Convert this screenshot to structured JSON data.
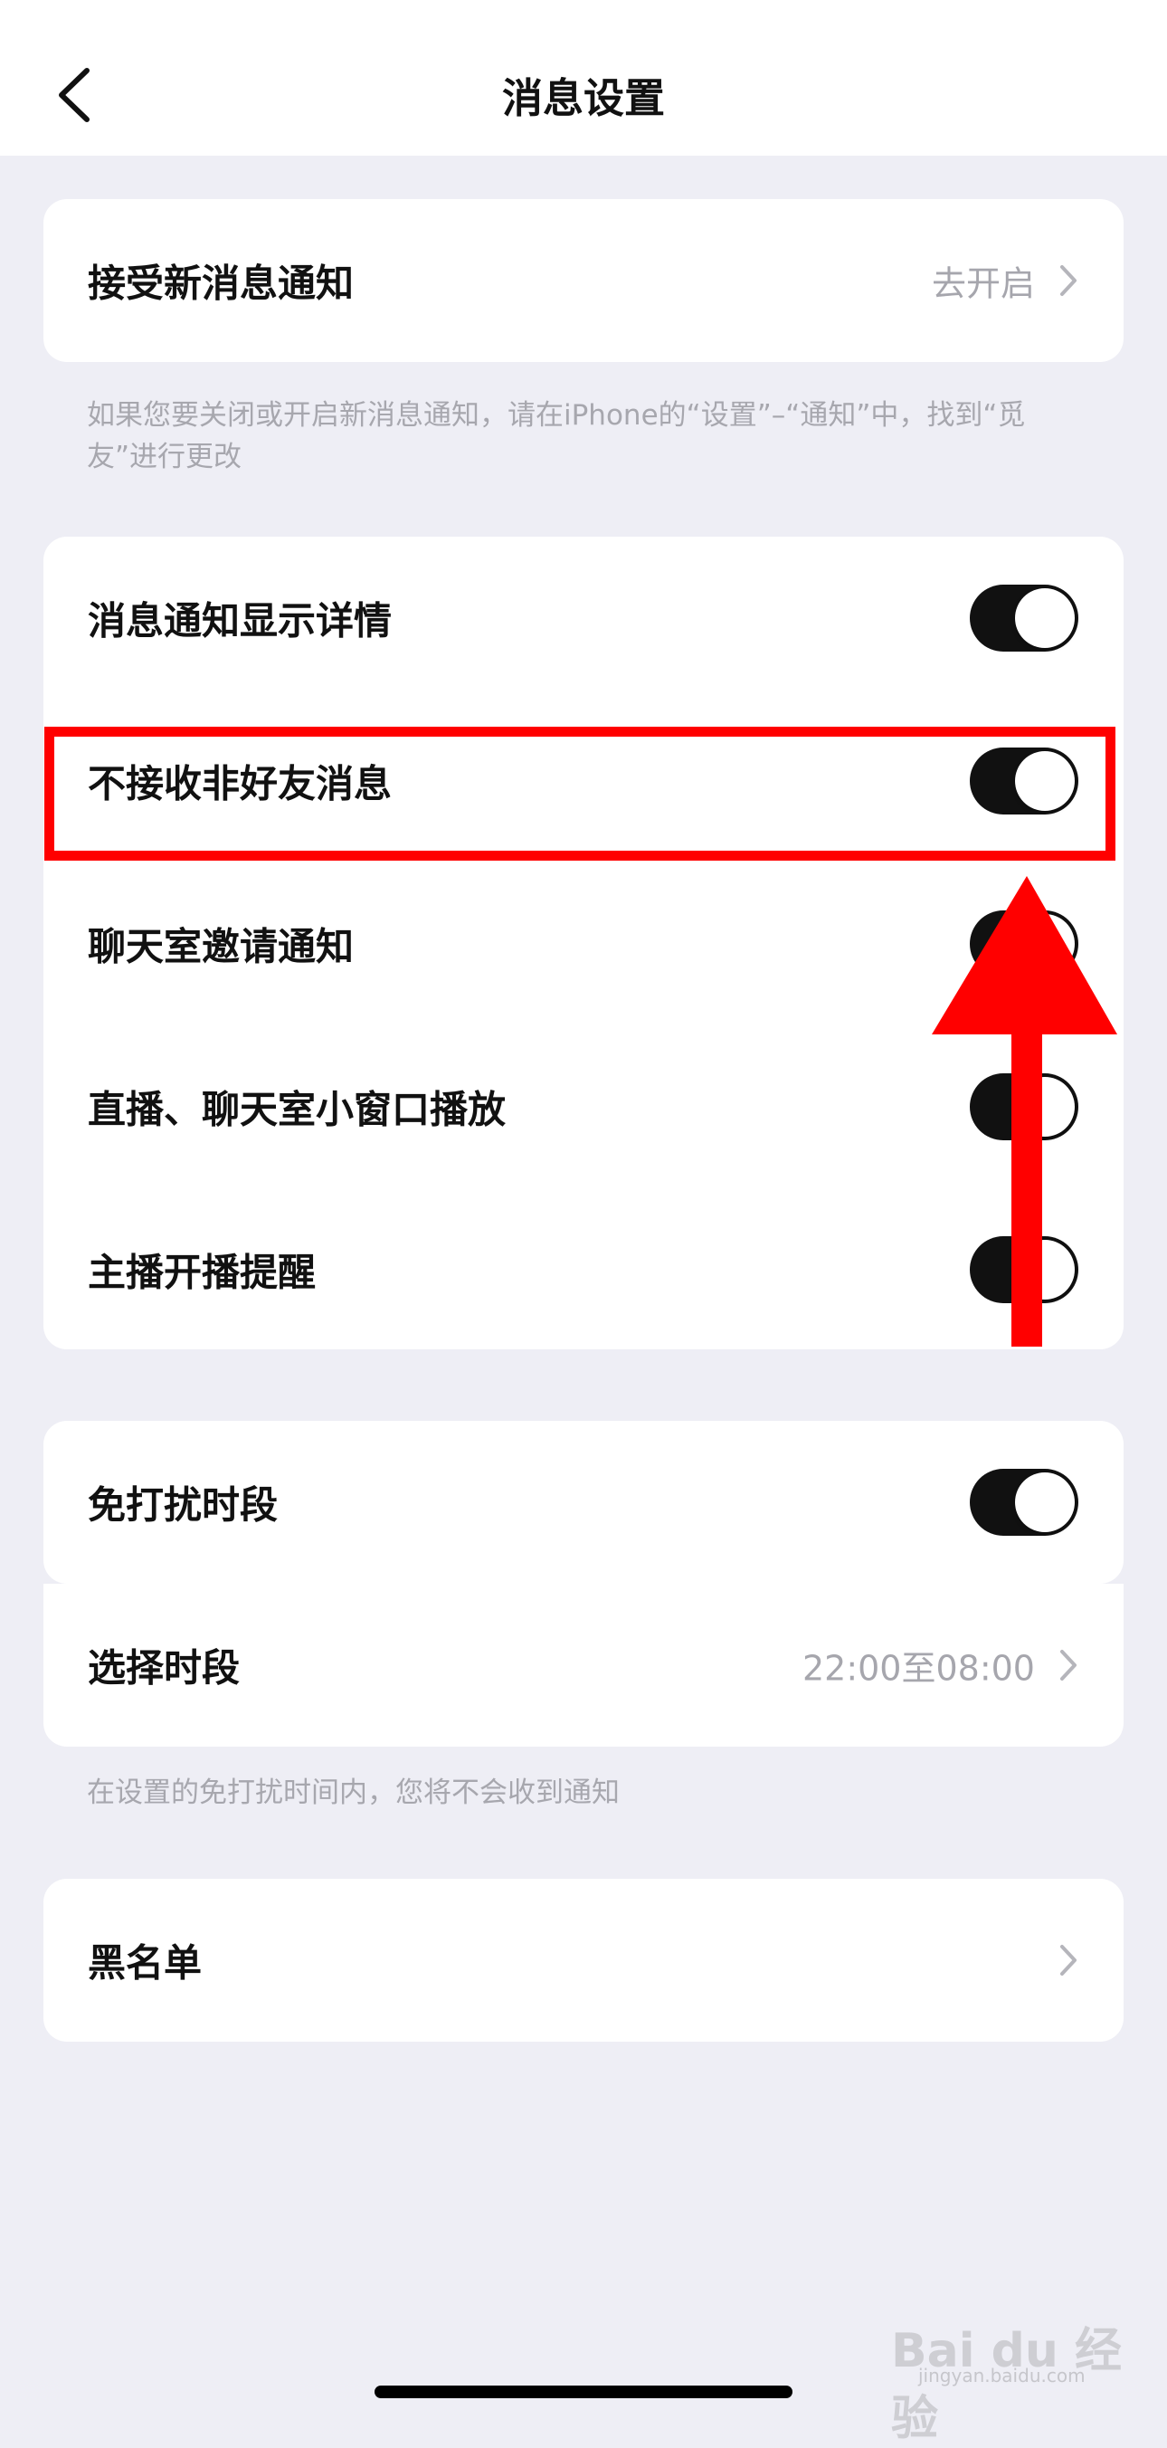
{
  "header": {
    "title": "消息设置",
    "back_icon": "chevron-left-icon"
  },
  "section_notifications": {
    "row": {
      "label": "接受新消息通知",
      "value": "去开启"
    },
    "note": "如果您要关闭或开启新消息通知，请在iPhone的“设置”–“通知”中，找到“觅友”进行更改"
  },
  "section_toggles": {
    "rows": [
      {
        "label": "消息通知显示详情",
        "on": true
      },
      {
        "label": "不接收非好友消息",
        "on": true
      },
      {
        "label": "聊天室邀请通知",
        "on": true
      },
      {
        "label": "直播、聊天室小窗口播放",
        "on": true
      },
      {
        "label": "主播开播提醒",
        "on": true
      }
    ]
  },
  "section_dnd": {
    "toggle_row": {
      "label": "免打扰时段",
      "on": true
    },
    "period_row": {
      "label": "选择时段",
      "value": "22:00至08:00"
    },
    "note": "在设置的免打扰时间内，您将不会收到通知"
  },
  "section_blacklist": {
    "label": "黑名单"
  },
  "annotation": {
    "highlight_color": "#ff0000",
    "arrow_color": "#ff0000"
  },
  "watermark": {
    "brand": "Bai du 经验",
    "url": "jingyan.baidu.com"
  },
  "colors": {
    "background": "#eeeef5",
    "toggle_on": "#111111"
  }
}
